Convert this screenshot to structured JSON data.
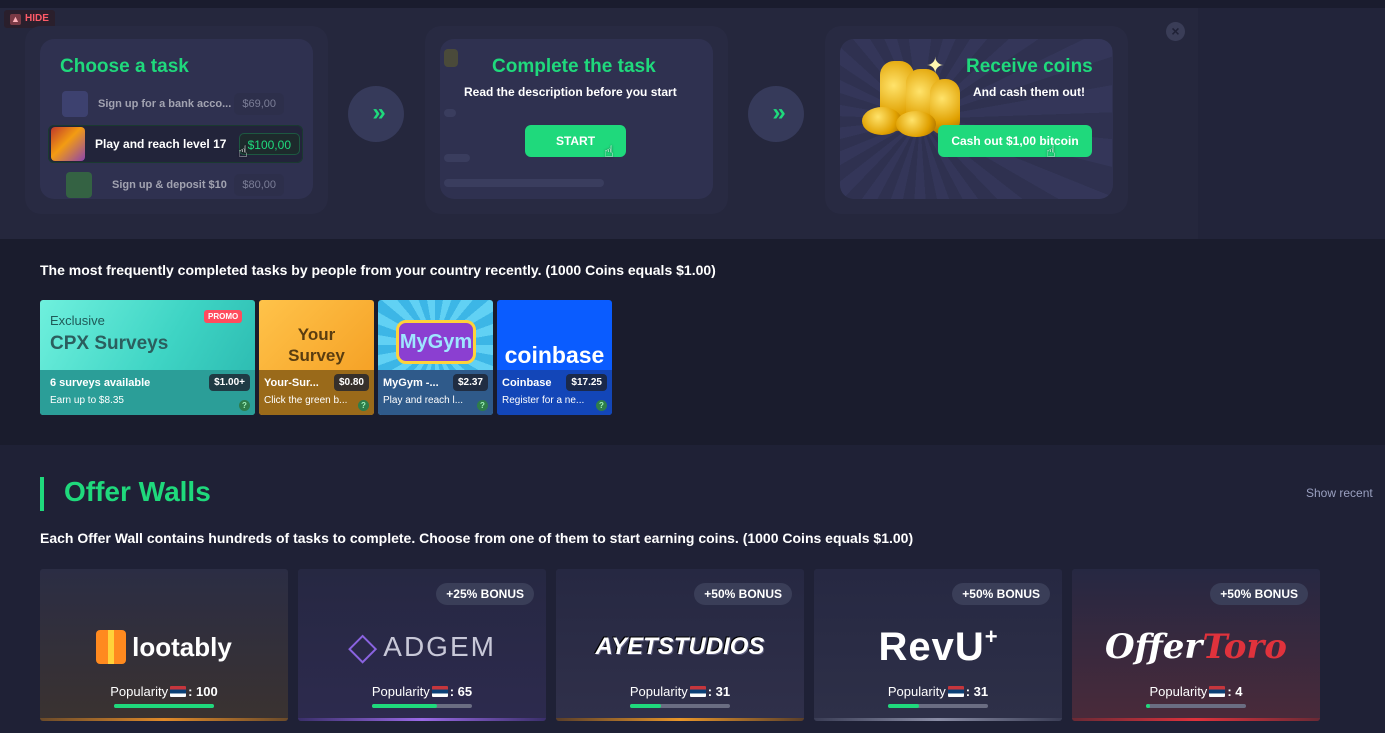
{
  "banner": {
    "hide_label": "HIDE",
    "step1": {
      "title": "Choose a task",
      "tasks": [
        {
          "label": "Sign up for a bank acco...",
          "amount": "$69,00"
        },
        {
          "label": "Play and reach level 17",
          "amount": "$100,00"
        },
        {
          "label": "Sign up & deposit $10",
          "amount": "$80,00"
        }
      ]
    },
    "step2": {
      "title": "Complete the task",
      "subtitle": "Read the description before you start",
      "button": "START"
    },
    "step3": {
      "title": "Receive coins",
      "subtitle": "And cash them out!",
      "button": "Cash out $1,00 bitcoin"
    }
  },
  "featured": {
    "heading": "The most frequently completed tasks by people from your country recently. (1000 Coins equals $1.00)",
    "cards": [
      {
        "tag": "Exclusive",
        "brand": "CPX Surveys",
        "badge": "PROMO",
        "name": "6 surveys available",
        "price": "$1.00+",
        "desc": "Earn up to $8.35"
      },
      {
        "brand": "Your Survey",
        "name": "Your-Sur...",
        "price": "$0.80",
        "desc": "Click the green b..."
      },
      {
        "brand": "MyGym",
        "name": "MyGym -...",
        "price": "$2.37",
        "desc": "Play and reach l..."
      },
      {
        "brand": "coinbase",
        "name": "Coinbase",
        "price": "$17.25",
        "desc": "Register for a ne..."
      }
    ]
  },
  "offer_walls": {
    "title": "Offer Walls",
    "show_recent": "Show recent",
    "description": "Each Offer Wall contains hundreds of tasks to complete. Choose from one of them to start earning coins. (1000 Coins equals $1.00)",
    "popularity_label": "Popularity",
    "walls": [
      {
        "name": "lootably",
        "bonus": "",
        "popularity": ": 100",
        "popularity_value": 100
      },
      {
        "name": "ADGEM",
        "bonus": "+25% BONUS",
        "popularity": ": 65",
        "popularity_value": 65
      },
      {
        "name": "AYETSTUDIOS",
        "bonus": "+50% BONUS",
        "popularity": ": 31",
        "popularity_value": 31
      },
      {
        "name": "RevU",
        "bonus": "+50% BONUS",
        "popularity": ": 31",
        "popularity_value": 31
      },
      {
        "name": "OfferToro",
        "bonus": "+50% BONUS",
        "popularity": ": 4",
        "popularity_value": 4
      }
    ]
  }
}
